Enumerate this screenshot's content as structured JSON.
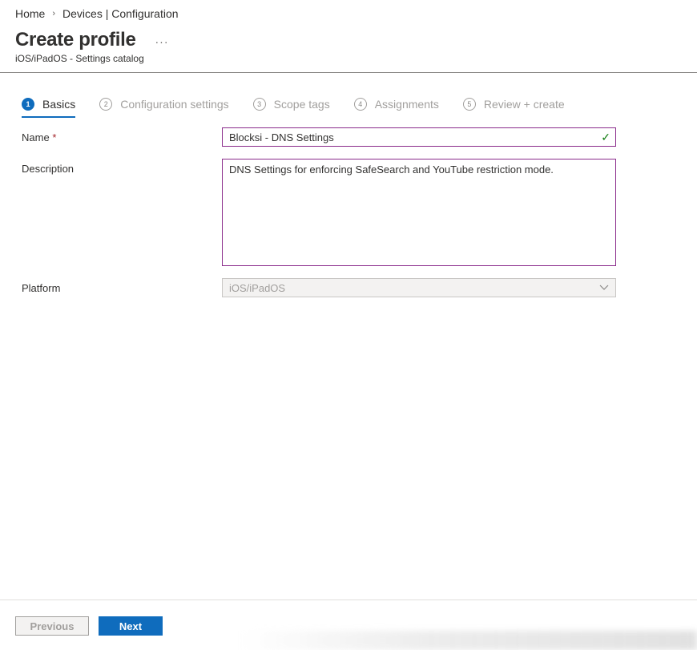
{
  "breadcrumb": {
    "items": [
      "Home",
      "Devices | Configuration"
    ]
  },
  "header": {
    "title": "Create profile",
    "more": "···",
    "subtitle": "iOS/iPadOS - Settings catalog"
  },
  "steps": [
    {
      "num": "1",
      "label": "Basics",
      "active": true
    },
    {
      "num": "2",
      "label": "Configuration settings",
      "active": false
    },
    {
      "num": "3",
      "label": "Scope tags",
      "active": false
    },
    {
      "num": "4",
      "label": "Assignments",
      "active": false
    },
    {
      "num": "5",
      "label": "Review + create",
      "active": false
    }
  ],
  "form": {
    "name_label": "Name",
    "required_marker": "*",
    "name_value": "Blocksi - DNS Settings",
    "description_label": "Description",
    "description_value": "DNS Settings for enforcing SafeSearch and YouTube restriction mode.",
    "platform_label": "Platform",
    "platform_value": "iOS/iPadOS"
  },
  "footer": {
    "previous_label": "Previous",
    "next_label": "Next"
  },
  "colors": {
    "accent": "#0f6cbd",
    "input_border": "#8a2b8b",
    "valid": "#107c10",
    "required": "#a4262c"
  },
  "icons": {
    "name_valid": "checkmark-icon",
    "platform_dropdown": "chevron-down-icon",
    "breadcrumb_separator": "chevron-right-icon"
  }
}
